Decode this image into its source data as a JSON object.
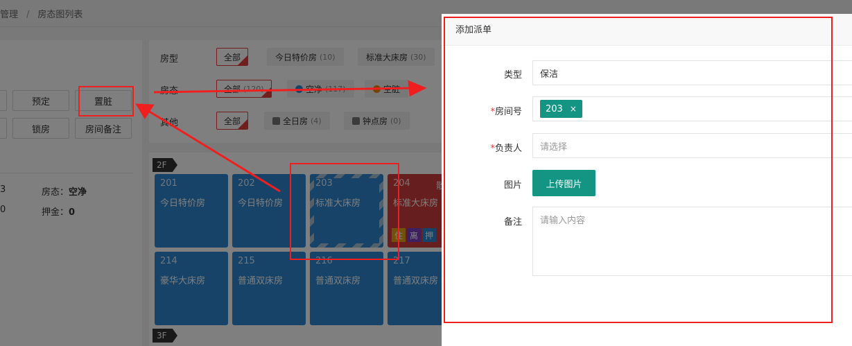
{
  "breadcrumb": [
    "管理",
    "房态图列表"
  ],
  "left": {
    "buttons_row1": [
      "预定",
      "置脏"
    ],
    "buttons_row2": [
      "锁房",
      "房间备注"
    ],
    "info": [
      {
        "label": "房态：",
        "value": "空净",
        "prefix": "3"
      },
      {
        "label": "押金：",
        "value": "0",
        "prefix": "0"
      }
    ]
  },
  "filters": {
    "rows": [
      {
        "label": "房型",
        "chips": [
          {
            "text": "全部",
            "selected": true,
            "count": ""
          },
          {
            "text": "今日特价房",
            "count": "(10)"
          },
          {
            "text": "标准大床房",
            "count": "(30)"
          }
        ]
      },
      {
        "label": "房态",
        "chips": [
          {
            "text": "全部",
            "selected": true,
            "count": "(120)"
          },
          {
            "text": "空净",
            "count": "(117)",
            "dot": "#2e87d1"
          },
          {
            "text": "空脏",
            "count": "",
            "dot": "#e68a00"
          }
        ]
      },
      {
        "label": "其他",
        "chips": [
          {
            "text": "全部",
            "selected": true,
            "count": ""
          },
          {
            "text": "全日房",
            "count": "(4)"
          },
          {
            "text": "钟点房",
            "count": "(0)"
          }
        ]
      }
    ]
  },
  "floors": [
    "2F",
    "3F"
  ],
  "rooms": [
    {
      "num": "201",
      "type": "今日特价房",
      "state": "normal"
    },
    {
      "num": "202",
      "type": "今日特价房",
      "state": "normal"
    },
    {
      "num": "203",
      "type": "标准大床房",
      "state": "dirty"
    },
    {
      "num": "204",
      "type": "标准大床房",
      "state": "occupied",
      "extra": "散",
      "badges": [
        {
          "t": "住",
          "c": "#e8a317"
        },
        {
          "t": "离",
          "c": "#7b3fc4"
        },
        {
          "t": "押",
          "c": "#2e87d1"
        }
      ]
    },
    {
      "num": "214",
      "type": "豪华大床房",
      "state": "normal"
    },
    {
      "num": "215",
      "type": "普通双床房",
      "state": "normal"
    },
    {
      "num": "216",
      "type": "普通双床房",
      "state": "normal"
    },
    {
      "num": "217",
      "type": "普通双床房",
      "state": "normal"
    }
  ],
  "dialog": {
    "title": "添加派单",
    "type_label": "类型",
    "type_value": "保洁",
    "room_label": "房间号",
    "room_tag": "203",
    "room_tag_close": "×",
    "owner_label": "负责人",
    "owner_placeholder": "请选择",
    "image_label": "图片",
    "upload_label": "上传图片",
    "note_label": "备注",
    "note_placeholder": "请输入内容",
    "required_mark": "*"
  },
  "colors": {
    "accent": "#149584",
    "annotation": "#f01f1f",
    "room_blue": "#2e87d1",
    "room_red": "#cf3c3c"
  }
}
